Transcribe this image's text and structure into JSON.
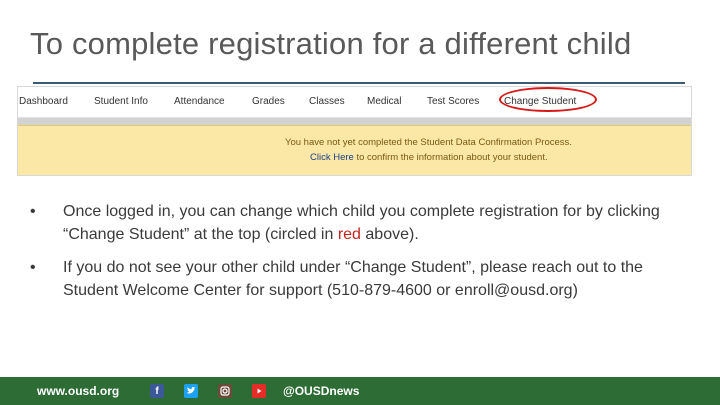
{
  "slide": {
    "title": "To complete registration for a different child"
  },
  "screenshot": {
    "nav": [
      {
        "label": "Dashboard"
      },
      {
        "label": "Student Info"
      },
      {
        "label": "Attendance"
      },
      {
        "label": "Grades"
      },
      {
        "label": "Classes"
      },
      {
        "label": "Medical"
      },
      {
        "label": "Test Scores"
      },
      {
        "label": "Change Student"
      }
    ],
    "highlighted_item": "Change Student",
    "notice": {
      "line1": "You have not yet completed the Student Data Confirmation Process.",
      "link": "Click Here",
      "line2_rest": " to confirm the information about your student."
    },
    "colors": {
      "highlight_circle": "#d61818",
      "notice_bg": "#fbe7a6"
    }
  },
  "bullets": {
    "b1_part1": "Once logged in, you can change which child you complete registration for by clicking “Change Student” at the top (circled in ",
    "b1_red": "red",
    "b1_part2": " above).",
    "b2": "If you do not see your other child under “Change Student”, please reach out to the Student Welcome Center for support (510-879-4600 or enroll@ousd.org)"
  },
  "footer": {
    "website": "www.ousd.org",
    "handle": "@OUSDnews",
    "icons": [
      "facebook-icon",
      "twitter-icon",
      "instagram-icon",
      "youtube-icon"
    ],
    "bg_color": "#2d6c34"
  }
}
